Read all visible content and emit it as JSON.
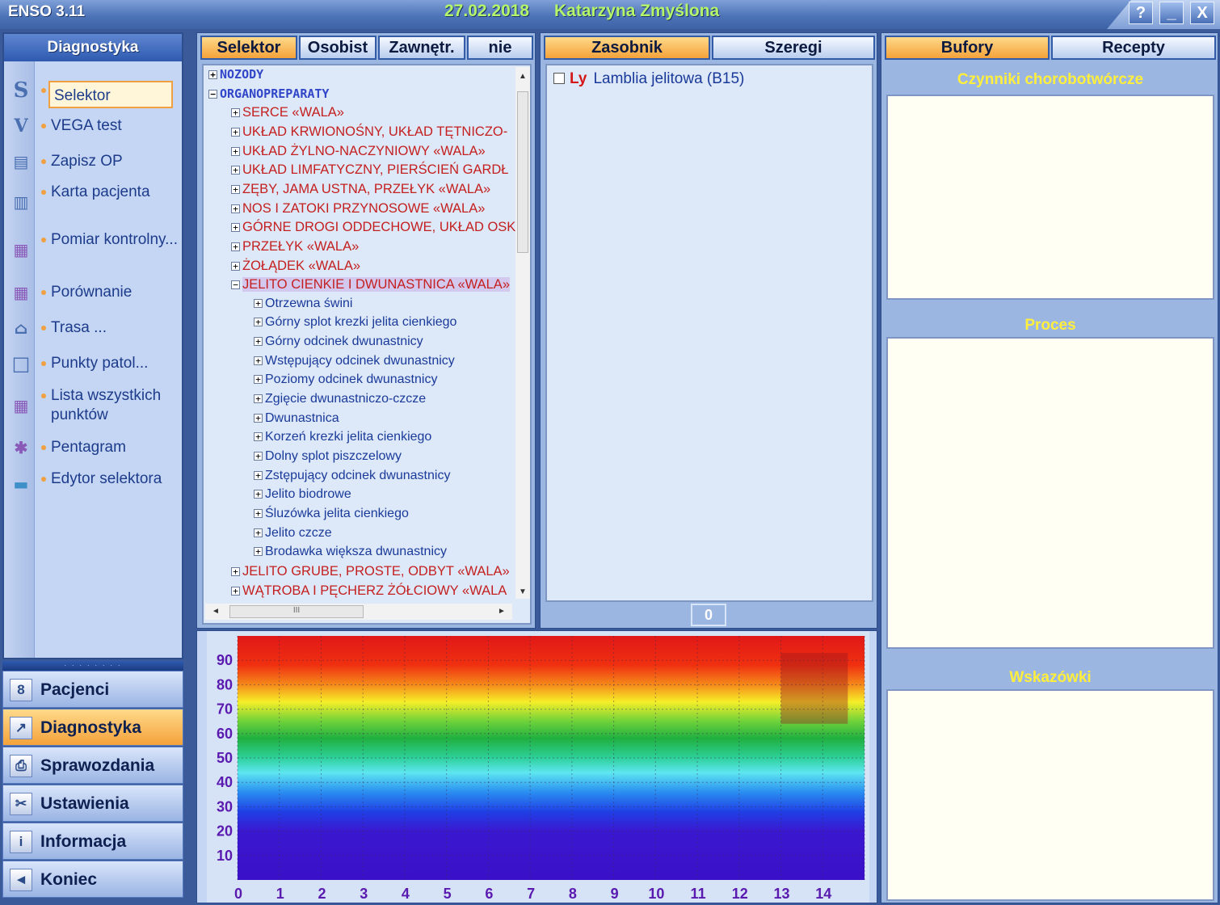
{
  "app": {
    "title": "ENSO 3.11",
    "date": "27.02.2018",
    "patient": "Katarzyna  Zmyślona",
    "window_buttons": [
      "?",
      "_",
      "X"
    ]
  },
  "left_nav": {
    "header": "Diagnostyka",
    "items": [
      {
        "icon": "selector-icon",
        "glyph": "S",
        "label": "Selektor",
        "selected": true
      },
      {
        "icon": "vega-icon",
        "glyph": "V",
        "label": "VEGA test"
      },
      {
        "icon": "save-op-icon",
        "glyph": "▤",
        "label": "Zapisz OP"
      },
      {
        "icon": "patient-card-icon",
        "glyph": "▥",
        "label": "Karta pacjenta"
      },
      {
        "icon": "control-measure-icon",
        "glyph": "▦",
        "label": "Pomiar kontrolny..."
      },
      {
        "icon": "compare-icon",
        "glyph": "▦",
        "label": "Porównanie"
      },
      {
        "icon": "route-icon",
        "glyph": "⌂",
        "label": "Trasa ..."
      },
      {
        "icon": "points-icon",
        "glyph": "□",
        "label": "Punkty patol..."
      },
      {
        "icon": "all-points-icon",
        "glyph": "▦",
        "label": "Lista wszystkich punktów"
      },
      {
        "icon": "pentagram-icon",
        "glyph": "✱",
        "label": "Pentagram"
      },
      {
        "icon": "folder-icon",
        "glyph": "▬",
        "label": "Edytor selektora"
      }
    ],
    "grip": "· · · · · · · ·",
    "modules": [
      {
        "icon": "patients-icon",
        "glyph": "8",
        "label": "Pacjenci"
      },
      {
        "icon": "diagnostics-icon",
        "glyph": "↗",
        "label": "Diagnostyka",
        "active": true
      },
      {
        "icon": "printer-icon",
        "glyph": "⎙",
        "label": "Sprawozdania"
      },
      {
        "icon": "tools-icon",
        "glyph": "✂",
        "label": "Ustawienia"
      },
      {
        "icon": "info-icon",
        "glyph": "i",
        "label": "Informacja"
      },
      {
        "icon": "exit-icon",
        "glyph": "◄",
        "label": "Koniec"
      }
    ]
  },
  "tree_panel": {
    "tabs": [
      "Selektor",
      "Osobist",
      "Zawnętr.",
      "nie"
    ],
    "rows": [
      {
        "level": 0,
        "expander": "+",
        "text": "NOZODY"
      },
      {
        "level": 0,
        "expander": "−",
        "text": "ORGANOPREPARATY"
      },
      {
        "level": 1,
        "expander": "+",
        "text": "SERCE «WALA»"
      },
      {
        "level": 1,
        "expander": "+",
        "text": "UKŁAD KRWIONOŚNY, UKŁAD TĘTNICZO-"
      },
      {
        "level": 1,
        "expander": "+",
        "text": "UKŁAD ŻYLNO-NACZYNIOWY «WALA»"
      },
      {
        "level": 1,
        "expander": "+",
        "text": "UKŁAD LIMFATYCZNY, PIERŚCIEŃ GARDŁ"
      },
      {
        "level": 1,
        "expander": "+",
        "text": "ZĘBY, JAMA USTNA, PRZEŁYK «WALA»"
      },
      {
        "level": 1,
        "expander": "+",
        "text": "NOS I ZATOKI PRZYNOSOWE «WALA»"
      },
      {
        "level": 1,
        "expander": "+",
        "text": "GÓRNE DROGI ODDECHOWE, UKŁAD OSK"
      },
      {
        "level": 1,
        "expander": "+",
        "text": "PRZEŁYK «WALA»"
      },
      {
        "level": 1,
        "expander": "+",
        "text": "ŻOŁĄDEK «WALA»"
      },
      {
        "level": 1,
        "expander": "−",
        "text": "JELITO CIENKIE I DWUNASTNICA «WALA»",
        "highlight": true
      },
      {
        "level": 2,
        "expander": "+",
        "text": "Otrzewna świni"
      },
      {
        "level": 2,
        "expander": "+",
        "text": "Górny splot krezki jelita cienkiego"
      },
      {
        "level": 2,
        "expander": "+",
        "text": "Górny odcinek dwunastnicy"
      },
      {
        "level": 2,
        "expander": "+",
        "text": "Wstępujący odcinek dwunastnicy"
      },
      {
        "level": 2,
        "expander": "+",
        "text": "Poziomy odcinek dwunastnicy"
      },
      {
        "level": 2,
        "expander": "+",
        "text": "Zgięcie dwunastniczo-czcze"
      },
      {
        "level": 2,
        "expander": "+",
        "text": "Dwunastnica"
      },
      {
        "level": 2,
        "expander": "+",
        "text": "Korzeń krezki jelita cienkiego"
      },
      {
        "level": 2,
        "expander": "+",
        "text": "Dolny splot piszczelowy"
      },
      {
        "level": 2,
        "expander": "+",
        "text": "Zstępujący odcinek dwunastnicy"
      },
      {
        "level": 2,
        "expander": "+",
        "text": "Jelito biodrowe"
      },
      {
        "level": 2,
        "expander": "+",
        "text": "Śluzówka jelita cienkiego"
      },
      {
        "level": 2,
        "expander": "+",
        "text": "Jelito czcze"
      },
      {
        "level": 2,
        "expander": "+",
        "text": "Brodawka większa dwunastnicy"
      },
      {
        "level": 1,
        "expander": "+",
        "text": "JELITO GRUBE, PROSTE, ODBYT «WALA»"
      },
      {
        "level": 1,
        "expander": "+",
        "text": "WĄTROBA I PĘCHERZ ŻÓŁCIOWY «WALA"
      }
    ],
    "hscroll_grip": "III"
  },
  "zasobnik_panel": {
    "tabs": [
      "Zasobnik",
      "Szeregi"
    ],
    "items": [
      {
        "code": "Ly",
        "label": "Lamblia jelitowa (B15)",
        "checked": false
      }
    ],
    "counter": "0"
  },
  "right_panel": {
    "tabs": [
      "Bufory",
      "Recepty"
    ],
    "sections": [
      "Czynniki chorobotwórcze",
      "Proces",
      "Wskazówki"
    ]
  },
  "chart_data": {
    "type": "heatmap",
    "x_ticks": [
      "0",
      "1",
      "2",
      "3",
      "4",
      "5",
      "6",
      "7",
      "8",
      "9",
      "10",
      "11",
      "12",
      "13",
      "14"
    ],
    "y_ticks": [
      "90",
      "80",
      "70",
      "60",
      "50",
      "40",
      "30",
      "20",
      "10"
    ],
    "xlim": [
      0,
      15
    ],
    "ylim": [
      0,
      100
    ],
    "grid": true,
    "color_scale": [
      {
        "value": 100,
        "color": "#e01818"
      },
      {
        "value": 88,
        "color": "#f03010"
      },
      {
        "value": 80,
        "color": "#f58a1a"
      },
      {
        "value": 73,
        "color": "#f6ee28"
      },
      {
        "value": 65,
        "color": "#6fd23a"
      },
      {
        "value": 58,
        "color": "#20b040"
      },
      {
        "value": 50,
        "color": "#2ed09a"
      },
      {
        "value": 44,
        "color": "#5ee6f0"
      },
      {
        "value": 36,
        "color": "#2a8ef0"
      },
      {
        "value": 28,
        "color": "#2040e6"
      },
      {
        "value": 20,
        "color": "#3a18d0"
      },
      {
        "value": 0,
        "color": "#3a10c8"
      }
    ],
    "highlight_region": {
      "x": [
        13,
        14.6
      ],
      "y": [
        64,
        93
      ]
    }
  }
}
